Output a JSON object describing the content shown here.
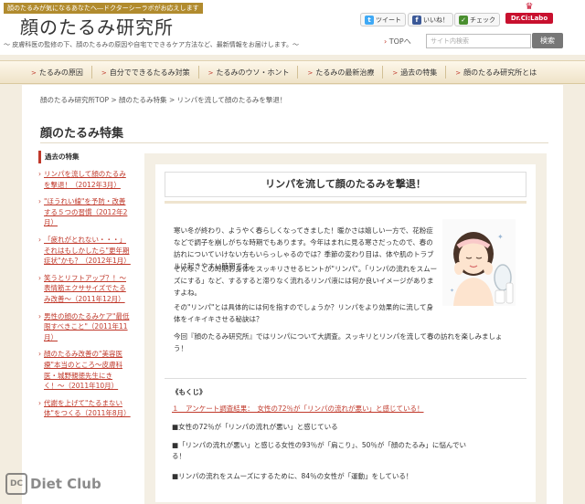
{
  "header": {
    "tagline": "顔のたるみが気になるあなたへ―ドクターシーラボがお応えします",
    "site_title": "顔のたるみ研究所",
    "site_desc": "〜 皮膚科医の監修の下、顔のたるみの原因や自宅でできるケア方法など、最新情報をお届けします。〜",
    "tweet_label": "ツイート",
    "like_label": "いいね！",
    "check_label": "チェック",
    "logo_text": "Dr.Ci:Labo",
    "top_link": "TOPへ",
    "search_placeholder": "サイト内検索",
    "search_button": "検索"
  },
  "nav": {
    "items": [
      {
        "label": "たるみの原因"
      },
      {
        "label": "自分でできるたるみ対策"
      },
      {
        "label": "たるみのウソ・ホント"
      },
      {
        "label": "たるみの最新治療"
      },
      {
        "label": "過去の特集"
      },
      {
        "label": "顔のたるみ研究所とは"
      }
    ]
  },
  "breadcrumb": "顔のたるみ研究所TOP > 顔のたるみ特集 > リンパを流して顔のたるみを撃退！",
  "page_title": "顔のたるみ特集",
  "sidebar": {
    "heading": "過去の特集",
    "items": [
      {
        "label": "リンパを流して顔のたるみを撃退！（2012年3月）"
      },
      {
        "label": "\"ほうれい線\"を予防・改善する５つの習慣（2012年2月）"
      },
      {
        "label": "「疲れがとれない・・・」それはもしかしたら\"更年期症状\"かも？（2012年1月）"
      },
      {
        "label": "笑うとリフトアップ？！〜表情筋エクササイズでたるみ改善〜（2011年12月）"
      },
      {
        "label": "男性の顔のたるみケア\"最低限すべきこと\"（2011年11月）"
      },
      {
        "label": "顔のたるみ改善の\"美容医療\"本当のところ〜皮膚科医・城野親徳先生にきく！〜（2011年10月）"
      },
      {
        "label": "代謝を上げて\"たるまない体\"をつくる（2011年8月）"
      }
    ]
  },
  "article": {
    "title": "リンパを流して顔のたるみを撃退！",
    "p1": "寒い冬が終わり、ようやく春らしくなってきました！暖かさは嬉しい一方で、花粉症などで調子を崩しがちな時期でもあります。今年はまれに見る寒さだったので、春の訪れについていけない方もいらっしゃるのでは？季節の変わり目は、体や肌のトラブルは起きやすい時期です。",
    "p2": "そんな、この時期お身体をスッキリさせるヒントが\"リンパ\"。「リンパの流れをスムーズにする」など、するすると滞りなく流れるリンパ液には何か良いイメージがありますよね。",
    "p3": "その\"リンパ\"とは具体的には何を指すのでしょうか？リンパをより効果的に流して身体をイキイキさせる秘訣は？",
    "p4": "今回『顔のたるみ研究所』ではリンパについて大調査。スッキリとリンパを流して春の訪れを楽しみましょう！",
    "mokuji": "《もくじ》",
    "toc_link": "１　アンケート調査結果：　女性の72％が「リンパの流れが悪い」と感じている！",
    "toc_1": "■女性の72％が「リンパの流れが悪い」と感じている",
    "toc_2": "■「リンパの流れが悪い」と感じる女性の93％が「肩こり」、50％が「顔のたるみ」に悩んでい",
    "toc_3": "る！",
    "toc_4": "■リンパの流れをスムーズにするために、84％の女性が「運動」をしている！"
  },
  "watermark": "Diet Club"
}
